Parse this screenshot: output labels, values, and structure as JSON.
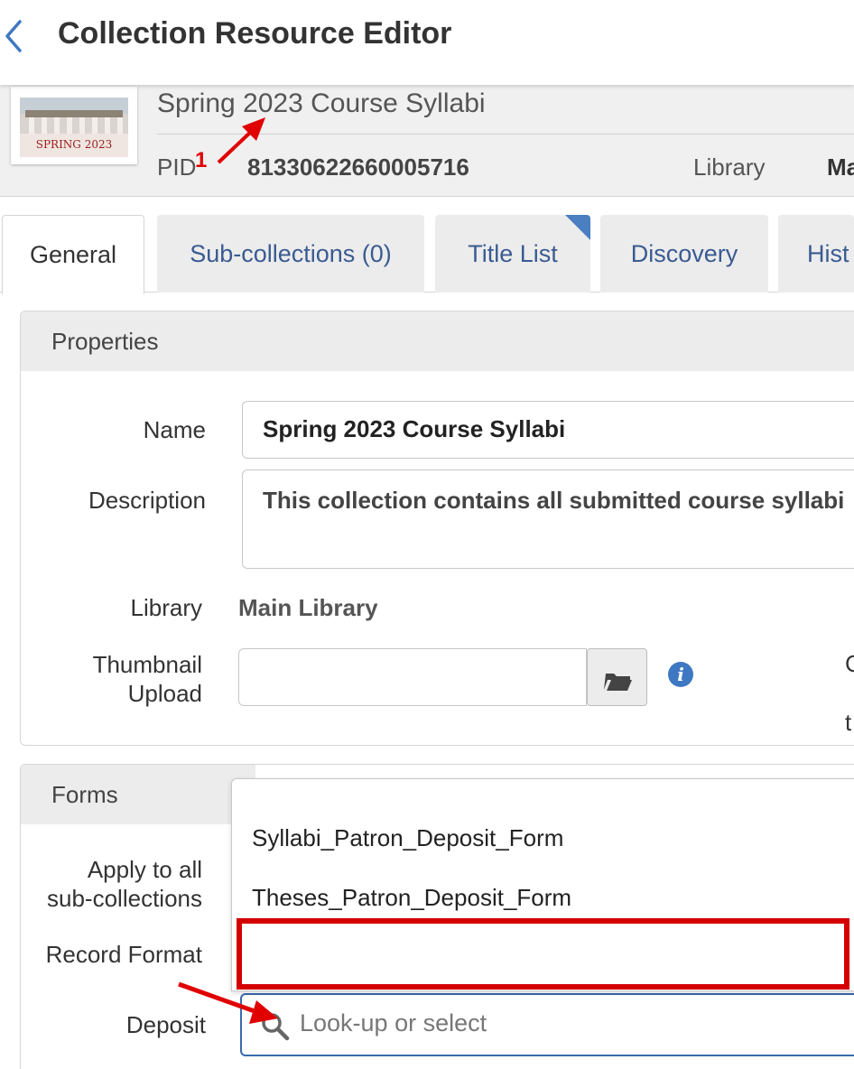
{
  "header": {
    "title": "Collection Resource Editor"
  },
  "record": {
    "title": "Spring 2023 Course Syllabi",
    "thumbnail_caption": "SPRING 2023",
    "pid_label": "PID",
    "pid_value": "81330622660005716",
    "library_label": "Library",
    "library_truncated": "Ma"
  },
  "tabs": [
    {
      "label": "General"
    },
    {
      "label": "Sub-collections (0)"
    },
    {
      "label": "Title List"
    },
    {
      "label": "Discovery"
    },
    {
      "label": "Hist"
    }
  ],
  "properties": {
    "heading": "Properties",
    "name_label": "Name",
    "name_value": "Spring 2023 Course Syllabi",
    "description_label": "Description",
    "description_value": "This collection contains all submitted course syllabi",
    "library_label": "Library",
    "library_value": "Main Library",
    "thumbnail_label_1": "Thumbnail",
    "thumbnail_label_2": "Upload",
    "right_trunc_1": "C",
    "right_trunc_2": "t"
  },
  "forms": {
    "heading": "Forms",
    "apply_label_1": "Apply to all",
    "apply_label_2": "sub-collections",
    "record_format_label": "Record Format",
    "deposit_label": "Deposit",
    "options": [
      "Syllabi_Patron_Deposit_Form",
      "Theses_Patron_Deposit_Form"
    ],
    "lookup_placeholder": "Look-up or select"
  },
  "annotations": {
    "marker_number": "1"
  },
  "colors": {
    "accent": "#3a6aad",
    "link": "#3a5b92",
    "highlight": "#d40000",
    "tab_corner": "#4a7fc1"
  }
}
